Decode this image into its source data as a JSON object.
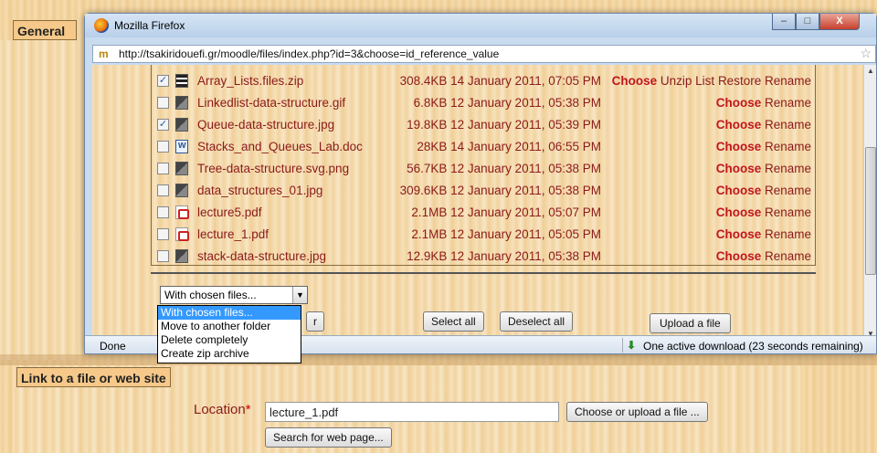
{
  "general": {
    "title": "General"
  },
  "window": {
    "title": "Mozilla Firefox",
    "url": "http://tsakiridouefi.gr/moodle/files/index.php?id=3&choose=id_reference_value",
    "min_glyph": "–",
    "max_glyph": "□",
    "close_glyph": "X"
  },
  "files": [
    {
      "name": "Array_Lists.files.zip",
      "size": "308.4KB",
      "date": "14 January 2011, 07:05 PM",
      "checked": true,
      "icon": "zip-icon",
      "actions": [
        "Choose",
        "Unzip",
        "List",
        "Restore",
        "Rename"
      ]
    },
    {
      "name": "Linkedlist-data-structure.gif",
      "size": "6.8KB",
      "date": "12 January 2011, 05:38 PM",
      "checked": false,
      "icon": "image-icon",
      "actions": [
        "Choose",
        "Rename"
      ]
    },
    {
      "name": "Queue-data-structure.jpg",
      "size": "19.8KB",
      "date": "12 January 2011, 05:39 PM",
      "checked": true,
      "icon": "image-icon",
      "actions": [
        "Choose",
        "Rename"
      ]
    },
    {
      "name": "Stacks_and_Queues_Lab.doc",
      "size": "28KB",
      "date": "14 January 2011, 06:55 PM",
      "checked": false,
      "icon": "word-doc-icon",
      "actions": [
        "Choose",
        "Rename"
      ]
    },
    {
      "name": "Tree-data-structure.svg.png",
      "size": "56.7KB",
      "date": "12 January 2011, 05:38 PM",
      "checked": false,
      "icon": "image-icon",
      "actions": [
        "Choose",
        "Rename"
      ]
    },
    {
      "name": "data_structures_01.jpg",
      "size": "309.6KB",
      "date": "12 January 2011, 05:38 PM",
      "checked": false,
      "icon": "image-icon",
      "actions": [
        "Choose",
        "Rename"
      ]
    },
    {
      "name": "lecture5.pdf",
      "size": "2.1MB",
      "date": "12 January 2011, 05:07 PM",
      "checked": false,
      "icon": "pdf-icon",
      "actions": [
        "Choose",
        "Rename"
      ]
    },
    {
      "name": "lecture_1.pdf",
      "size": "2.1MB",
      "date": "12 January 2011, 05:05 PM",
      "checked": false,
      "icon": "pdf-icon",
      "actions": [
        "Choose",
        "Rename"
      ]
    },
    {
      "name": "stack-data-structure.jpg",
      "size": "12.9KB",
      "date": "12 January 2011, 05:38 PM",
      "checked": false,
      "icon": "image-icon",
      "actions": [
        "Choose",
        "Rename"
      ]
    }
  ],
  "bulk": {
    "select_value": "With chosen files...",
    "options": [
      "With chosen files...",
      "Move to another folder",
      "Delete completely",
      "Create zip archive"
    ],
    "hidden_button_tail": "r",
    "select_all": "Select all",
    "deselect_all": "Deselect all",
    "upload": "Upload a file"
  },
  "status": {
    "left": "Done",
    "download": "One active download (23 seconds remaining)"
  },
  "link_section": {
    "title": "Link to a file or web site",
    "location_label": "Location",
    "required_mark": "*",
    "location_value": "lecture_1.pdf",
    "choose_upload": "Choose or upload a file ...",
    "search_web": "Search for web page..."
  }
}
